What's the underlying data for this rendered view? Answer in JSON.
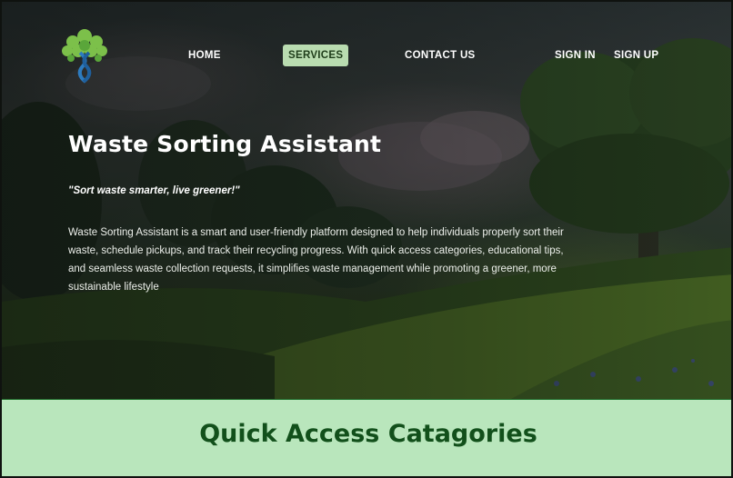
{
  "nav": {
    "home": "HOME",
    "services": "SERVICES",
    "contact": "CONTACT US",
    "sign_in": "SIGN IN",
    "sign_up": "SIGN UP",
    "active": "services"
  },
  "hero": {
    "title": "Waste Sorting Assistant",
    "tagline": "\"Sort waste smarter, live greener!\"",
    "description": "Waste Sorting Assistant is a smart and user-friendly platform designed to help individuals properly sort their waste, schedule pickups, and track their recycling progress. With quick access categories, educational tips, and seamless waste collection requests, it simplifies waste management while promoting a greener, more sustainable lifestyle"
  },
  "quick_access": {
    "title": "Quick Access Catagories"
  },
  "colors": {
    "active_nav_bg": "#b9dcb0",
    "section_bg": "#b9e6bc",
    "section_title": "#12501b"
  },
  "icons": {
    "logo": "tree-recycle-logo"
  }
}
